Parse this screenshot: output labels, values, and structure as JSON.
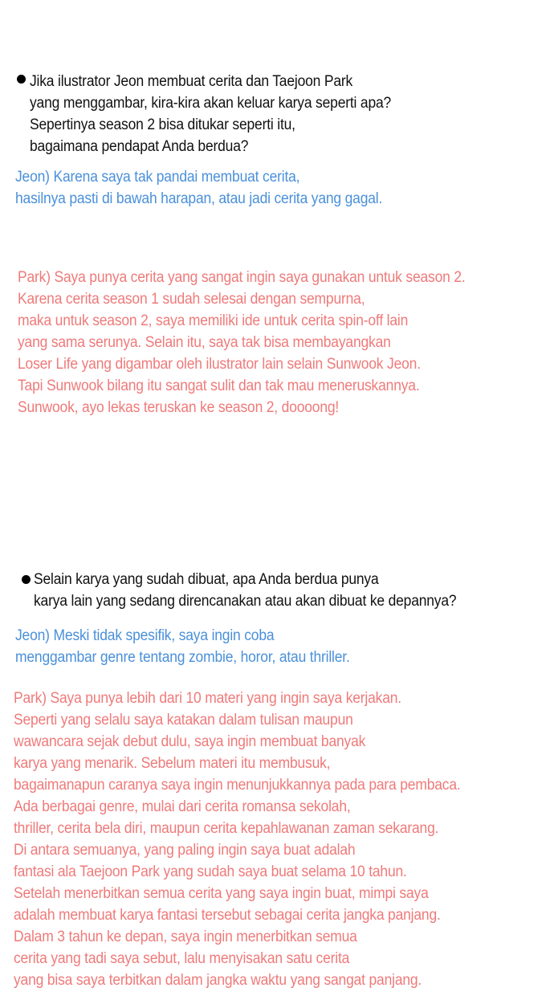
{
  "q1": {
    "lines": [
      "Jika ilustrator Jeon membuat cerita dan Taejoon Park",
      "yang menggambar, kira-kira akan keluar karya seperti apa?",
      "Sepertinya season 2 bisa ditukar seperti itu,",
      "bagaimana pendapat Anda berdua?"
    ]
  },
  "jeon1": {
    "lines": [
      "Jeon) Karena saya tak pandai membuat cerita,",
      "hasilnya pasti di bawah harapan, atau jadi cerita yang gagal."
    ]
  },
  "park1": {
    "lines": [
      "Park) Saya punya cerita yang sangat ingin saya gunakan untuk season 2.",
      "Karena cerita season 1 sudah selesai dengan sempurna,",
      "maka untuk season 2, saya memiliki ide untuk cerita spin-off lain",
      "yang sama serunya. Selain itu, saya tak bisa membayangkan",
      "Loser Life yang digambar oleh ilustrator lain selain Sunwook Jeon.",
      "Tapi Sunwook bilang itu sangat sulit dan tak mau meneruskannya.",
      "Sunwook, ayo lekas teruskan ke season 2, doooong!"
    ]
  },
  "q2": {
    "lines": [
      "Selain karya yang sudah dibuat, apa Anda berdua punya",
      "karya lain yang sedang direncanakan atau akan dibuat ke depannya?"
    ]
  },
  "jeon2": {
    "lines": [
      "Jeon) Meski tidak spesifik, saya ingin coba",
      "menggambar genre tentang zombie, horor, atau thriller."
    ]
  },
  "park2": {
    "lines": [
      "Park) Saya punya lebih dari 10 materi yang ingin saya kerjakan.",
      "Seperti yang selalu saya katakan dalam tulisan maupun",
      "wawancara sejak debut dulu, saya ingin membuat banyak",
      "karya yang menarik. Sebelum materi itu membusuk,",
      "bagaimanapun caranya saya ingin menunjukkannya pada para pembaca.",
      "Ada berbagai genre, mulai dari cerita romansa sekolah,",
      "thriller, cerita bela diri, maupun cerita kepahlawanan zaman sekarang.",
      "Di antara semuanya, yang paling ingin saya buat adalah",
      "fantasi ala Taejoon Park yang sudah saya buat selama 10 tahun.",
      "Setelah menerbitkan semua cerita yang saya ingin buat, mimpi saya",
      "adalah membuat karya fantasi tersebut sebagai cerita jangka panjang.",
      "Dalam 3 tahun ke depan, saya ingin menerbitkan semua",
      "cerita yang tadi saya sebut, lalu menyisakan satu cerita",
      "yang bisa saya terbitkan dalam jangka waktu yang sangat panjang."
    ]
  },
  "colors": {
    "question": "#111111",
    "jeon": "#4a90d9",
    "park": "#ef7a7a"
  }
}
